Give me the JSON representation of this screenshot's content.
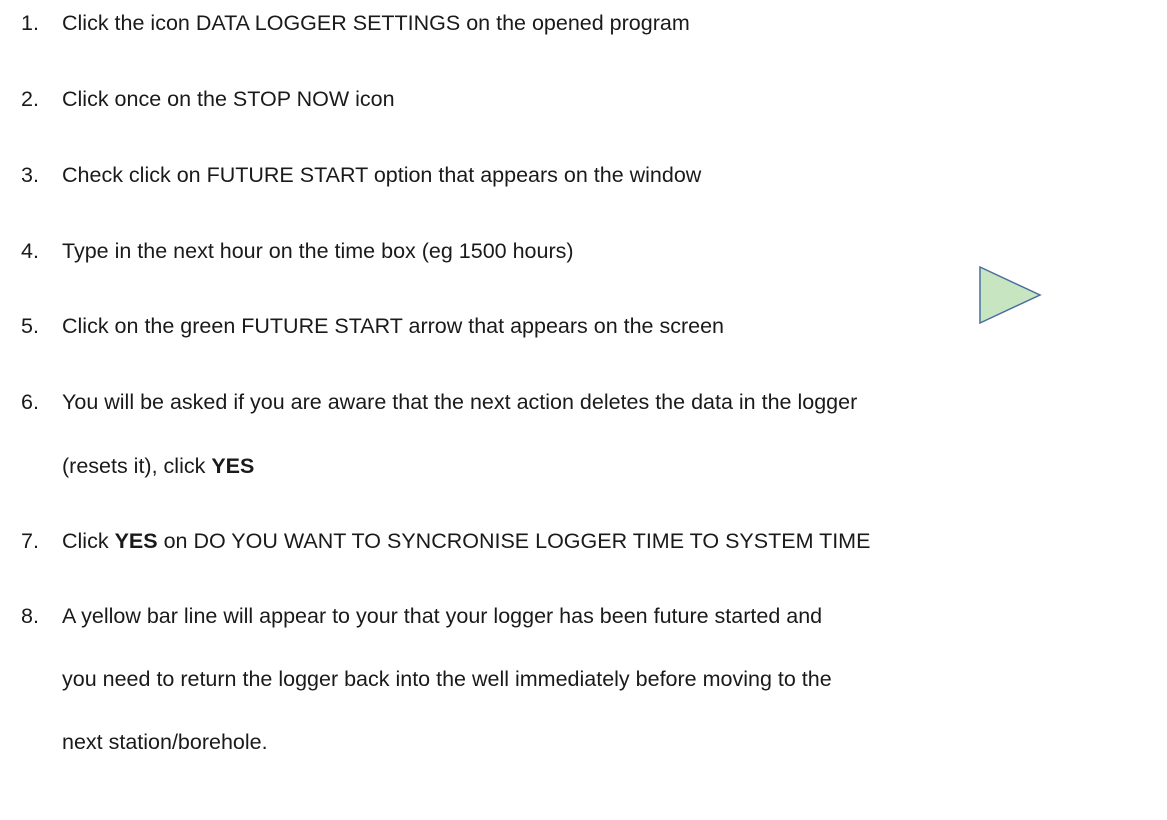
{
  "steps": [
    {
      "num": "1.",
      "text": "Click the icon DATA LOGGER SETTINGS  on the opened program"
    },
    {
      "num": "2.",
      "text": "Click once on the STOP NOW  icon"
    },
    {
      "num": "3.",
      "text": "Check click on FUTURE START  option that appears on the window"
    },
    {
      "num": "4.",
      "text": "Type in the next hour on the time box (eg 1500 hours)"
    },
    {
      "num": "5.",
      "text": "Click on the green FUTURE START arrow that appears on the screen"
    },
    {
      "num": "6.",
      "text": "You will be asked if you are aware that the next action deletes the data in the logger",
      "cont_text": "(resets it), click ",
      "cont_bold": "YES"
    },
    {
      "num": "7.",
      "bold": "YES",
      "pre": "Click ",
      "post": " on DO YOU WANT TO SYNCRONISE LOGGER TIME TO SYSTEM TIME"
    },
    {
      "num": "8.",
      "text": "A yellow bar line will appear to your that your logger has been future started and",
      "cont_lines": [
        "you need to return the logger back into the well immediately before moving to the",
        "next station/borehole."
      ]
    }
  ],
  "arrow_icon": {
    "name": "future-start-arrow-icon",
    "fill": "#c7e5c0",
    "stroke": "#4a6e9e"
  }
}
